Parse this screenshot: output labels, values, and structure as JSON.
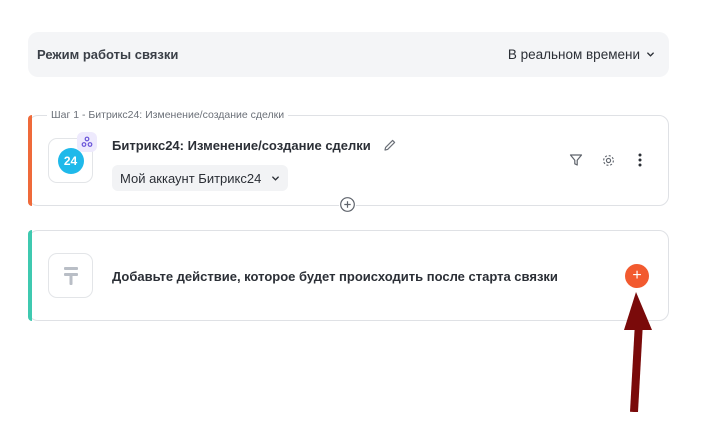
{
  "mode": {
    "label": "Режим работы связки",
    "value": "В реальном времени"
  },
  "step": {
    "caption": "Шаг 1 - Битрикс24: Изменение/создание сделки",
    "app_icon_text": "24",
    "title": "Битрикс24: Изменение/создание сделки",
    "account": "Мой аккаунт Битрикс24",
    "icons": [
      "webhook-icon",
      "pencil-icon",
      "filter-icon",
      "gear-icon",
      "more-vertical-icon"
    ]
  },
  "add_step": {
    "text": "Добавьте действие, которое будет происходить после старта связки",
    "plus": "+"
  },
  "colors": {
    "step_accent": "#ef6a3a",
    "add_accent": "#3fc9b0",
    "plus_button": "#f25a2f",
    "bitrix_blue": "#1fb9ea",
    "annotation_arrow": "#7a0a0a"
  }
}
